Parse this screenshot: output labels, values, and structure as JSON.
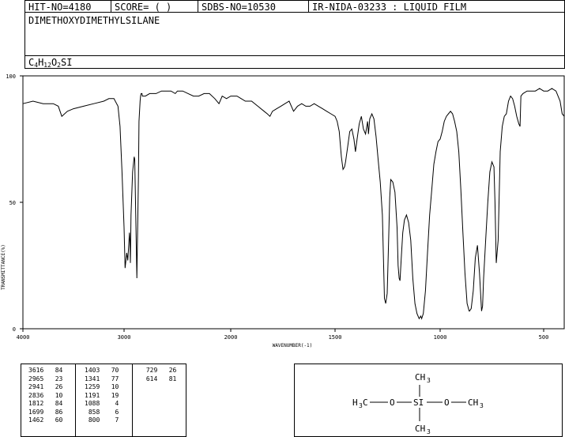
{
  "header": {
    "hit_no": "HIT-NO=4180",
    "score": "SCORE=  (   )",
    "sdbs_no": "SDBS-NO=10530",
    "ir_info": "IR-NIDA-03233 : LIQUID FILM"
  },
  "compound": {
    "name": "DIMETHOXYDIMETHYLSILANE",
    "formula_parts": [
      "C",
      "4",
      "H",
      "12",
      "O",
      "2",
      "SI"
    ]
  },
  "chart_data": {
    "type": "line",
    "xlabel": "WAVENUMBER(-1)",
    "ylabel": "TRANSMITTANCE(%)",
    "xlim": [
      4000,
      400
    ],
    "ylim": [
      0,
      100
    ],
    "x_ticks": [
      "4000",
      "3000",
      "2000",
      "1500",
      "1000",
      "500"
    ],
    "y_ticks": [
      "100",
      "50",
      "0"
    ],
    "series": [
      {
        "x": [
          4000,
          3900,
          3800,
          3700,
          3650,
          3616,
          3560,
          3500,
          3400,
          3300,
          3200,
          3150,
          3100,
          3060,
          3040,
          3020,
          3000,
          2990,
          2975,
          2965,
          2955,
          2950,
          2945,
          2941,
          2935,
          2920,
          2905,
          2900,
          2895,
          2880,
          2865,
          2860,
          2850,
          2845,
          2840,
          2836,
          2832,
          2828,
          2820,
          2800,
          2760,
          2720,
          2700,
          2650,
          2600,
          2560,
          2520,
          2500,
          2450,
          2400,
          2350,
          2300,
          2250,
          2200,
          2150,
          2110,
          2100,
          2080,
          2040,
          2000,
          1970,
          1950,
          1930,
          1900,
          1870,
          1840,
          1825,
          1812,
          1800,
          1780,
          1760,
          1740,
          1720,
          1699,
          1680,
          1660,
          1640,
          1620,
          1600,
          1580,
          1560,
          1540,
          1520,
          1500,
          1490,
          1480,
          1470,
          1462,
          1455,
          1450,
          1440,
          1430,
          1420,
          1410,
          1403,
          1395,
          1385,
          1375,
          1365,
          1355,
          1345,
          1341,
          1335,
          1325,
          1315,
          1305,
          1295,
          1285,
          1275,
          1265,
          1259,
          1252,
          1245,
          1240,
          1235,
          1225,
          1215,
          1205,
          1200,
          1195,
          1191,
          1185,
          1178,
          1170,
          1160,
          1150,
          1140,
          1130,
          1120,
          1110,
          1100,
          1092,
          1088,
          1080,
          1070,
          1060,
          1050,
          1040,
          1030,
          1020,
          1010,
          1000,
          990,
          980,
          970,
          960,
          950,
          940,
          930,
          920,
          910,
          900,
          890,
          880,
          870,
          860,
          858,
          850,
          840,
          830,
          820,
          810,
          800,
          795,
          790,
          780,
          770,
          760,
          750,
          740,
          735,
          729,
          720,
          710,
          700,
          690,
          680,
          670,
          660,
          650,
          640,
          630,
          620,
          614,
          610,
          600,
          580,
          560,
          540,
          520,
          500,
          480,
          460,
          440,
          420,
          410,
          400
        ],
        "y": [
          89,
          90,
          89,
          89,
          88,
          84,
          86,
          87,
          88,
          89,
          90,
          91,
          91,
          88,
          80,
          62,
          40,
          24,
          30,
          27,
          34,
          38,
          35,
          26,
          45,
          62,
          68,
          67,
          55,
          20,
          60,
          82,
          90,
          92,
          93,
          93,
          93,
          92,
          92,
          92,
          93,
          93,
          93,
          94,
          94,
          94,
          93,
          94,
          94,
          93,
          92,
          92,
          93,
          93,
          91,
          89,
          90,
          92,
          91,
          92,
          92,
          91,
          90,
          90,
          88,
          86,
          85,
          84,
          86,
          87,
          88,
          89,
          90,
          86,
          88,
          89,
          88,
          88,
          89,
          88,
          87,
          86,
          85,
          84,
          82,
          78,
          68,
          63,
          64,
          66,
          72,
          78,
          79,
          75,
          70,
          75,
          81,
          84,
          79,
          77,
          82,
          77,
          83,
          85,
          83,
          76,
          67,
          58,
          45,
          12,
          10,
          14,
          35,
          52,
          59,
          58,
          54,
          40,
          25,
          20,
          19,
          28,
          38,
          43,
          45,
          42,
          35,
          20,
          10,
          6,
          4,
          5,
          4,
          6,
          15,
          30,
          45,
          55,
          65,
          70,
          74,
          75,
          78,
          82,
          84,
          85,
          86,
          85,
          82,
          78,
          70,
          55,
          38,
          22,
          10,
          7,
          7,
          8,
          15,
          28,
          33,
          22,
          7,
          9,
          20,
          35,
          50,
          62,
          66,
          64,
          50,
          26,
          35,
          70,
          80,
          84,
          85,
          90,
          92,
          91,
          88,
          84,
          81,
          80,
          92,
          93,
          94,
          94,
          94,
          95,
          94,
          94,
          95,
          94,
          90,
          85,
          84
        ]
      }
    ]
  }
}
